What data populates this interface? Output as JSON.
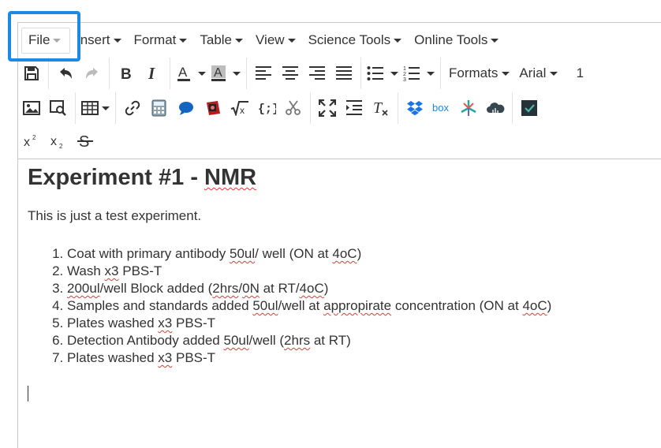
{
  "menubar": {
    "items": [
      "File",
      "Insert",
      "Format",
      "Table",
      "View",
      "Science Tools",
      "Online Tools"
    ]
  },
  "toolbar": {
    "formats_label": "Formats",
    "font_label": "Arial",
    "row1_overflow": "1",
    "superscript_glyph": "x",
    "subscript_glyph": "x"
  },
  "icons": {
    "row1": [
      "save-icon",
      "undo-icon",
      "redo-icon",
      "bold-icon",
      "italic-icon",
      "text-color-icon",
      "background-color-icon",
      "align-left-icon",
      "align-center-icon",
      "align-right-icon",
      "align-justify-icon",
      "bullet-list-icon",
      "numbered-list-icon"
    ],
    "row2": [
      "image-icon",
      "search-replace-icon",
      "table-icon",
      "link-icon",
      "calculator-icon",
      "speech-bubble-icon",
      "video-icon",
      "formula-icon",
      "code-icon",
      "scissors-icon",
      "fullscreen-icon",
      "indent-icon",
      "clear-format-icon",
      "dropbox-icon",
      "box-icon",
      "chemistry-icon",
      "cloud-icon",
      "checkbox-icon"
    ],
    "row3": [
      "superscript-icon",
      "subscript-icon",
      "strikethrough-icon"
    ],
    "colors": {
      "highlight": "#1e88e5",
      "spellcheck": "#e53935",
      "dropbox": "#1a73e8",
      "box": "#1e88e5"
    }
  },
  "document": {
    "title_parts": [
      "Experiment #1 - ",
      "NMR"
    ],
    "intro": "This is just a test experiment.",
    "steps": [
      [
        [
          "Coat with primary antibody ",
          0
        ],
        [
          "50ul",
          1
        ],
        [
          "/ well (ON at ",
          0
        ],
        [
          "4oC",
          1
        ],
        [
          ")",
          0
        ]
      ],
      [
        [
          "Wash ",
          0
        ],
        [
          "x3",
          1
        ],
        [
          " PBS-T",
          0
        ]
      ],
      [
        [
          "200ul",
          1
        ],
        [
          "/well Block added (",
          0
        ],
        [
          "2hrs",
          1
        ],
        [
          "/",
          0
        ],
        [
          "0N",
          1
        ],
        [
          " at RT/",
          0
        ],
        [
          "4oC",
          1
        ],
        [
          ")",
          0
        ]
      ],
      [
        [
          "Samples and standards added ",
          0
        ],
        [
          "50ul",
          1
        ],
        [
          "/well at ",
          0
        ],
        [
          "appropirate",
          1
        ],
        [
          " concentration (ON at ",
          0
        ],
        [
          "4oC",
          1
        ],
        [
          ")",
          0
        ]
      ],
      [
        [
          "Plates washed ",
          0
        ],
        [
          "x3",
          1
        ],
        [
          " PBS-T",
          0
        ]
      ],
      [
        [
          "Detection Antibody added ",
          0
        ],
        [
          "50ul",
          1
        ],
        [
          "/well (",
          0
        ],
        [
          "2hrs",
          1
        ],
        [
          " at RT)",
          0
        ]
      ],
      [
        [
          "Plates washed ",
          0
        ],
        [
          "x3",
          1
        ],
        [
          " PBS-T",
          0
        ]
      ]
    ]
  }
}
